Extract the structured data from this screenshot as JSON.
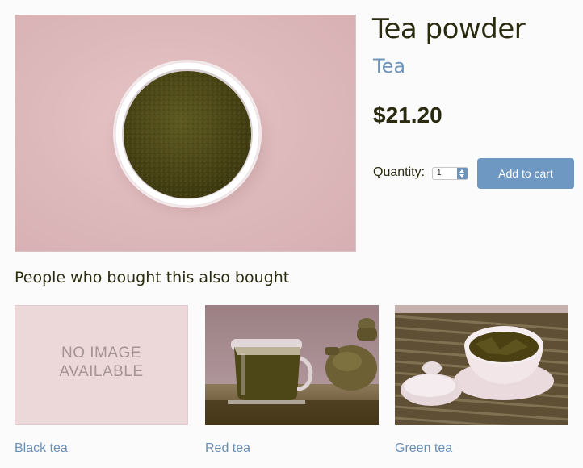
{
  "product": {
    "title": "Tea powder",
    "category": "Tea",
    "price": "$21.20",
    "image_icon": "tea-powder-bowl-image"
  },
  "purchase": {
    "quantity_label": "Quantity:",
    "quantity_value": "1",
    "add_to_cart_label": "Add to cart"
  },
  "related": {
    "heading": "People who bought this also bought",
    "items": [
      {
        "name": "Black tea",
        "image_text_line1": "NO IMAGE",
        "image_text_line2": "AVAILABLE",
        "image_icon": "no-image-placeholder"
      },
      {
        "name": "Red tea",
        "image_icon": "red-tea-glass-image"
      },
      {
        "name": "Green tea",
        "image_icon": "green-tea-bowl-image"
      }
    ]
  },
  "colors": {
    "accent": "#6e97c1",
    "link": "#6a8fb7",
    "text": "#2a2a10",
    "image_tint": "#e0bec1"
  }
}
